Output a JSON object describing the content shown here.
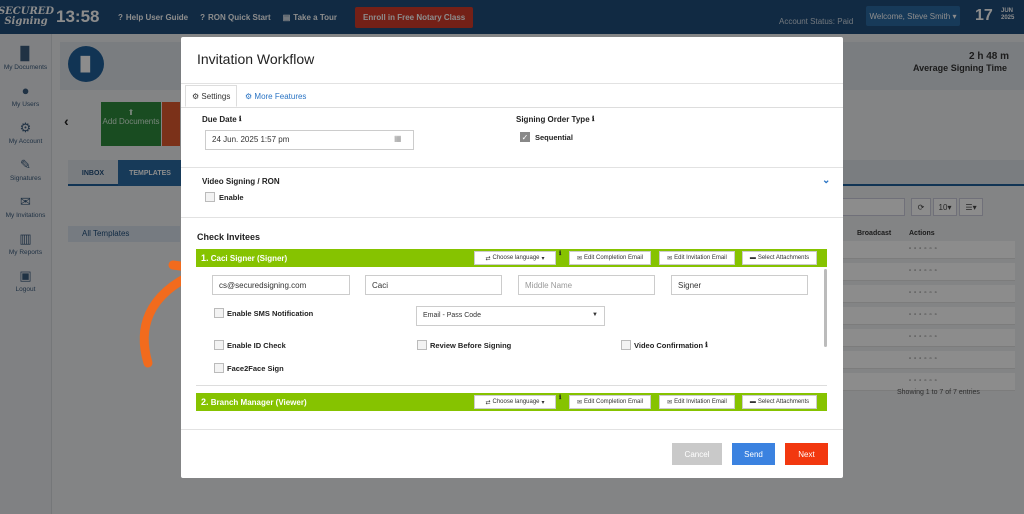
{
  "topbar": {
    "logo_line1": "SECURED",
    "logo_line2": "Signing",
    "clock": "13:58",
    "links": [
      {
        "icon": "question-circle-icon",
        "glyph": "?",
        "label": "Help User Guide"
      },
      {
        "icon": "question-circle-icon",
        "glyph": "?",
        "label": "RON Quick Start"
      },
      {
        "icon": "map-icon",
        "glyph": "▤",
        "label": "Take a Tour"
      }
    ],
    "enroll_label": "Enroll in Free Notary Class",
    "account_status": "Account Status: Paid",
    "welcome": "Welcome, Steve Smith",
    "date_day": "17",
    "date_month": "JUN",
    "date_year": "2025"
  },
  "sidebar": {
    "items": [
      {
        "icon": "document-icon",
        "glyph": "▉",
        "label": "My Documents"
      },
      {
        "icon": "user-icon",
        "glyph": "●",
        "label": "My Users"
      },
      {
        "icon": "gear-icon",
        "glyph": "⚙",
        "label": "My Account"
      },
      {
        "icon": "pen-icon",
        "glyph": "✎",
        "label": "Signatures"
      },
      {
        "icon": "envelope-icon",
        "glyph": "✉",
        "label": "My Invitations"
      },
      {
        "icon": "chart-icon",
        "glyph": "▥",
        "label": "My Reports"
      },
      {
        "icon": "lock-icon",
        "glyph": "▣",
        "label": "Logout"
      }
    ]
  },
  "background": {
    "stat_value": "2 h 48 m",
    "stat_label": "Average Signing Time",
    "add_documents_label": "Add Documents",
    "tabs": [
      "INBOX",
      "TEMPLATES"
    ],
    "all_templates": "All Templates",
    "page_size": "10",
    "columns": [
      "Broadcast",
      "Actions"
    ],
    "showing": "Showing 1 to 7 of 7 entries"
  },
  "modal": {
    "title": "Invitation Workflow",
    "tabs": [
      {
        "icon": "gear-icon",
        "label": "Settings"
      },
      {
        "icon": "gears-icon",
        "label": "More Features"
      }
    ],
    "due_date_label": "Due Date",
    "due_date_value": "24 Jun. 2025 1:57 pm",
    "signing_order_label": "Signing Order Type",
    "sequential_label": "Sequential",
    "sequential_checked": true,
    "video_label": "Video Signing / RON",
    "enable_label": "Enable",
    "check_invitees_label": "Check Invitees",
    "invitees": [
      {
        "number": "1.",
        "name": "Caci Signer (Signer)",
        "email": "cs@securedsigning.com",
        "first_name": "Caci",
        "middle_placeholder": "Middle Name",
        "last_name": "Signer"
      },
      {
        "number": "2.",
        "name": "Branch Manager (Viewer)"
      }
    ],
    "bar_buttons": {
      "language": "Choose language",
      "completion": "Edit Completion Email",
      "invitation": "Edit Invitation Email",
      "attachments": "Select Attachments"
    },
    "options": {
      "sms": "Enable SMS Notification",
      "auth_select": "Email - Pass Code",
      "id_check": "Enable ID Check",
      "review": "Review Before Signing",
      "video_conf": "Video Confirmation",
      "face2face": "Face2Face Sign"
    },
    "buttons": {
      "cancel": "Cancel",
      "send": "Send",
      "next": "Next"
    },
    "colors": {
      "invitee_bar": "#86c300",
      "cancel": "#c9c9c9",
      "send": "#3b82e0",
      "next": "#f2380f",
      "arrow": "#f26b1d"
    }
  }
}
